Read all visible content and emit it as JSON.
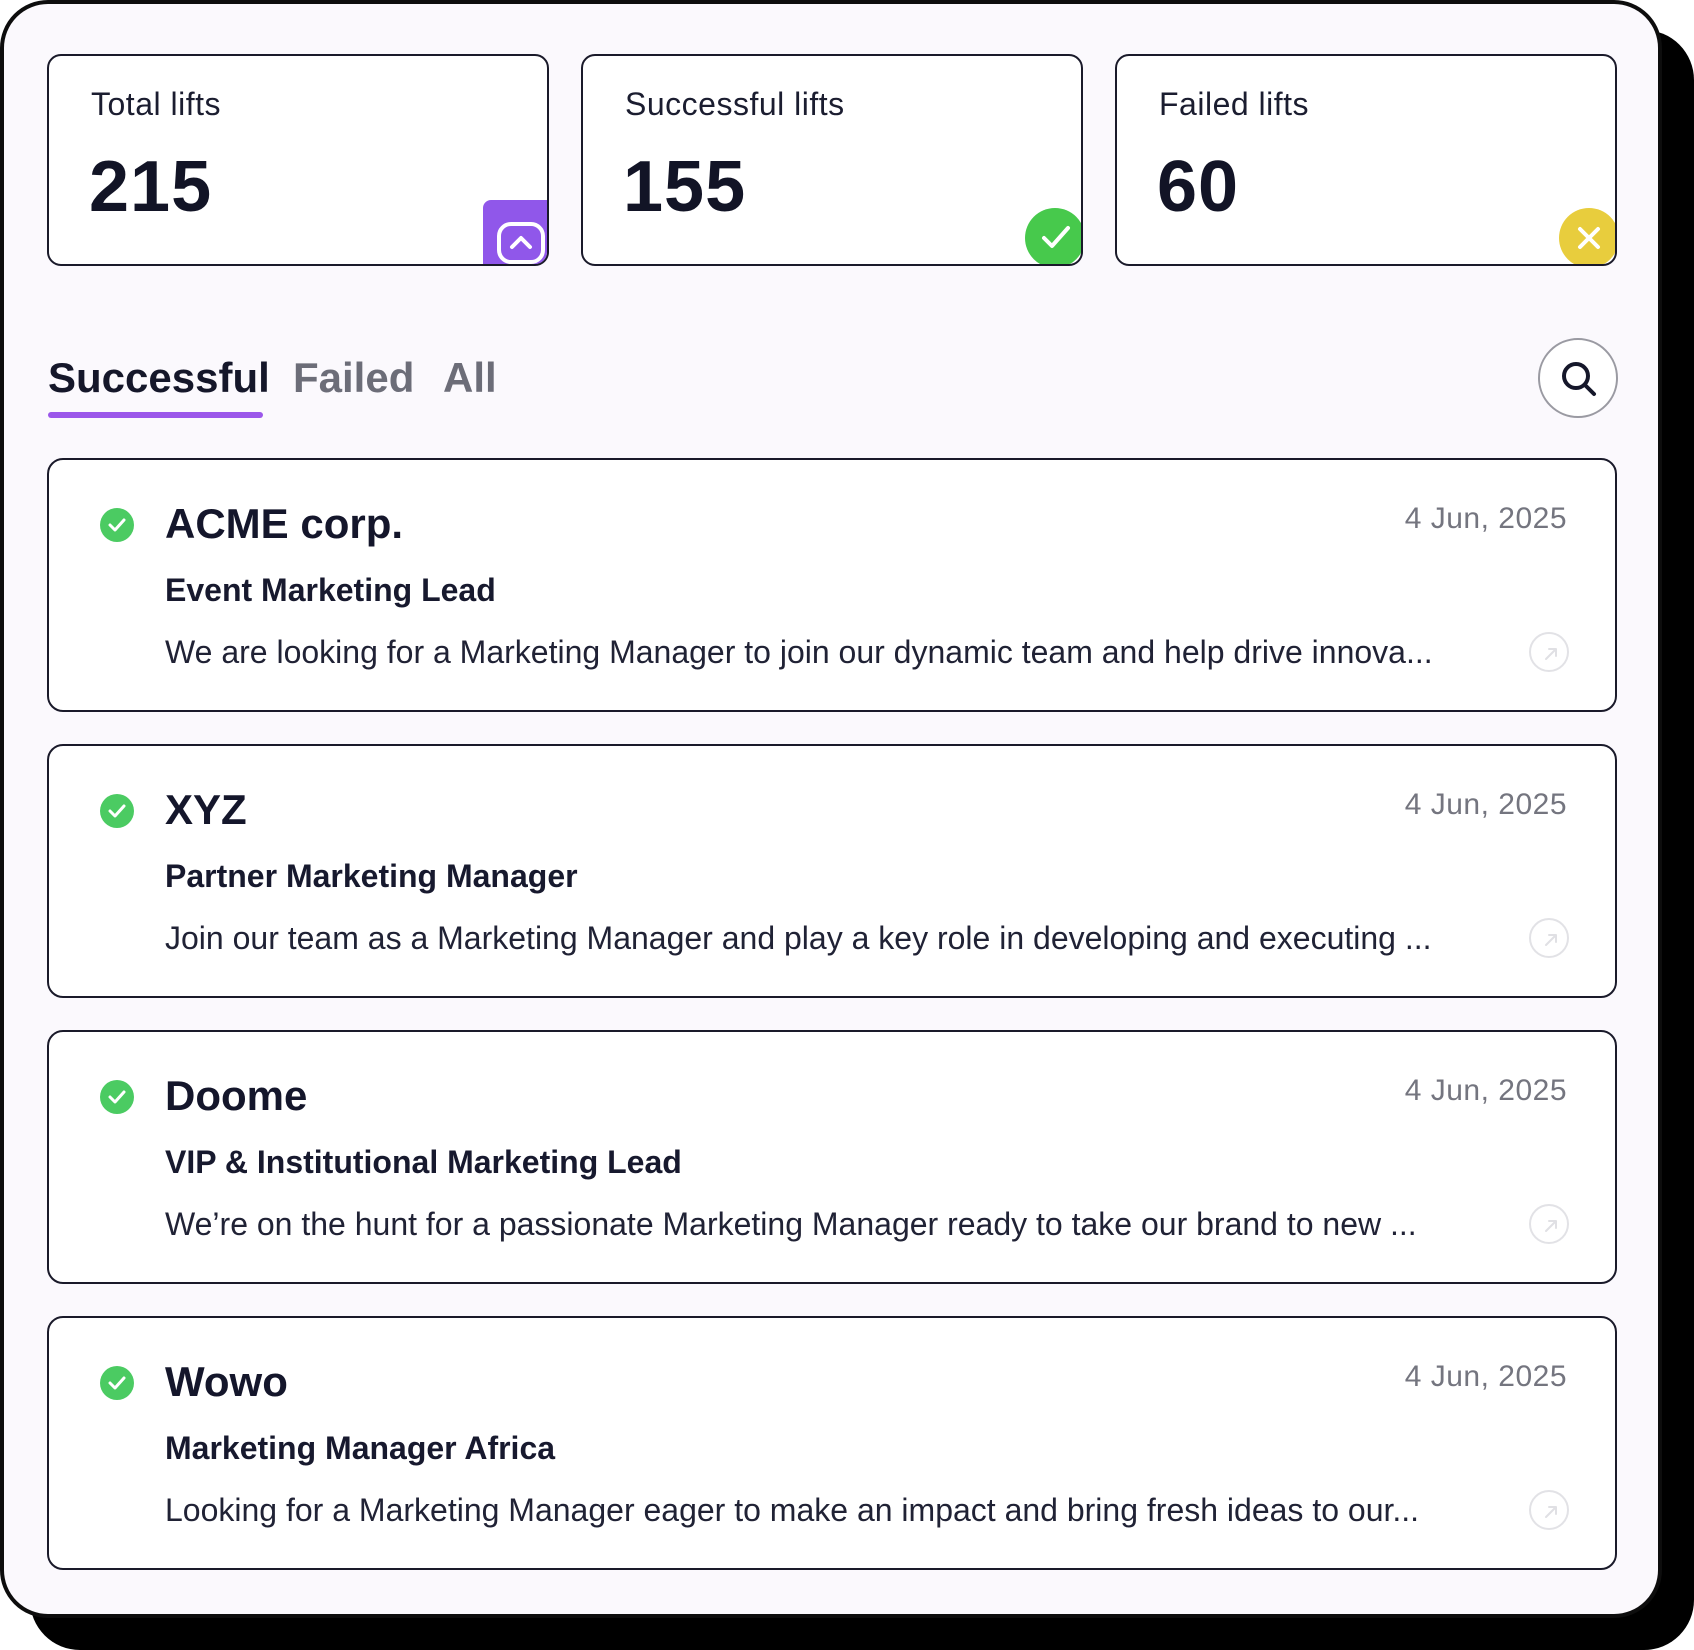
{
  "stats": [
    {
      "label": "Total lifts",
      "value": "215",
      "icon": "chevron-up-icon",
      "color": "#9057ea"
    },
    {
      "label": "Successful lifts",
      "value": "155",
      "icon": "check-icon",
      "color": "#47c94c"
    },
    {
      "label": "Failed lifts",
      "value": "60",
      "icon": "x-icon",
      "color": "#e8cd3d"
    }
  ],
  "tabs": [
    {
      "label": "Successful",
      "active": true
    },
    {
      "label": "Failed",
      "active": false
    },
    {
      "label": "All",
      "active": false
    }
  ],
  "search": {
    "icon": "search-icon"
  },
  "jobs": [
    {
      "company": "ACME corp.",
      "date": "4 Jun, 2025",
      "role": "Event Marketing Lead",
      "description": "We are looking for a Marketing Manager to join our dynamic team and help drive innova...",
      "status": "success"
    },
    {
      "company": "XYZ",
      "date": "4 Jun, 2025",
      "role": "Partner Marketing Manager",
      "description": "Join our team as a Marketing Manager and play a key role in developing and executing ...",
      "status": "success"
    },
    {
      "company": "Doome",
      "date": "4 Jun, 2025",
      "role": "VIP & Institutional Marketing Lead",
      "description": "We’re on the hunt for a passionate Marketing Manager ready to take our brand to new ...",
      "status": "success"
    },
    {
      "company": "Wowo",
      "date": "4 Jun, 2025",
      "role": "Marketing Manager Africa",
      "description": "Looking for a Marketing Manager eager to make an impact and bring fresh ideas to our...",
      "status": "success"
    }
  ],
  "colors": {
    "accent": "#9b57ea",
    "success": "#4bcb62",
    "failed": "#e8cd3d"
  }
}
